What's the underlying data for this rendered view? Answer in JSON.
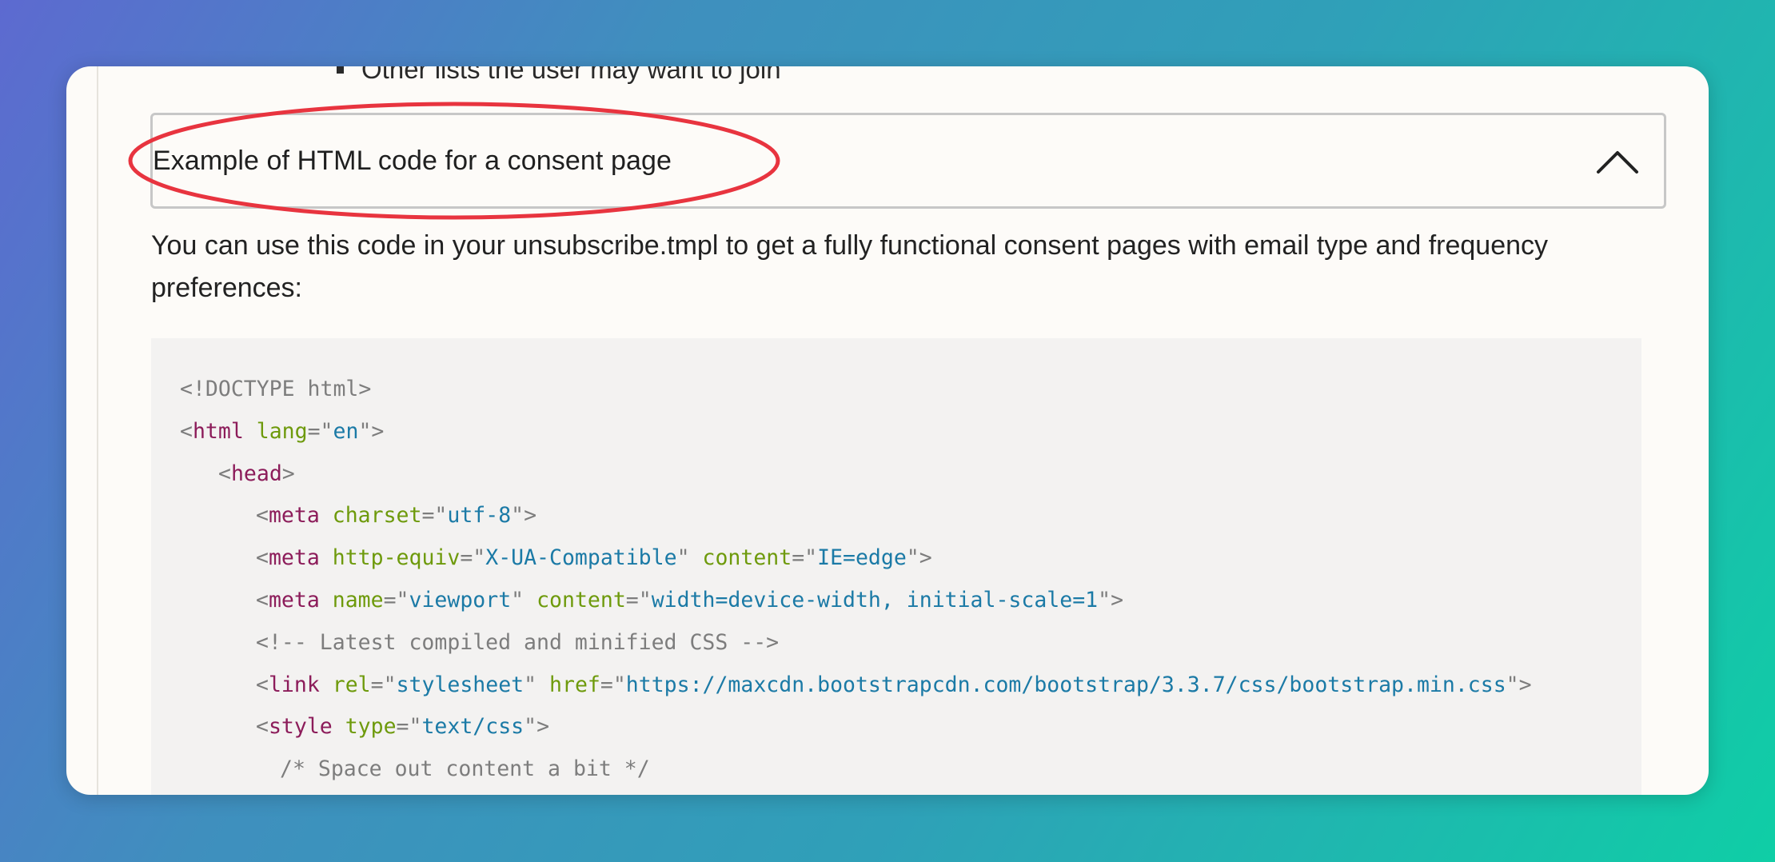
{
  "bullet": {
    "text": "Other lists the user may want to join"
  },
  "accordion": {
    "title": "Example of HTML code for a consent page",
    "chevron_icon": "chevron-up-icon",
    "expanded": true
  },
  "annotation": {
    "color": "#e8343f",
    "shape": "ellipse"
  },
  "intro": {
    "text": "You can use this code in your unsubscribe.tmpl to get a fully functional consent pages with email type and frequency preferences:"
  },
  "code": {
    "lines": [
      {
        "indent": 0,
        "tokens": [
          {
            "t": "punc",
            "v": "<!DOCTYPE html>"
          }
        ]
      },
      {
        "indent": 0,
        "tokens": [
          {
            "t": "punc",
            "v": "<"
          },
          {
            "t": "tag",
            "v": "html"
          },
          {
            "t": "plain",
            "v": " "
          },
          {
            "t": "attr",
            "v": "lang"
          },
          {
            "t": "punc",
            "v": "=\""
          },
          {
            "t": "val",
            "v": "en"
          },
          {
            "t": "punc",
            "v": "\">"
          }
        ]
      },
      {
        "indent": 1,
        "tokens": [
          {
            "t": "punc",
            "v": "<"
          },
          {
            "t": "tag",
            "v": "head"
          },
          {
            "t": "punc",
            "v": ">"
          }
        ]
      },
      {
        "indent": 2,
        "tokens": [
          {
            "t": "punc",
            "v": "<"
          },
          {
            "t": "tag",
            "v": "meta"
          },
          {
            "t": "plain",
            "v": " "
          },
          {
            "t": "attr",
            "v": "charset"
          },
          {
            "t": "punc",
            "v": "=\""
          },
          {
            "t": "val",
            "v": "utf-8"
          },
          {
            "t": "punc",
            "v": "\">"
          }
        ]
      },
      {
        "indent": 2,
        "tokens": [
          {
            "t": "punc",
            "v": "<"
          },
          {
            "t": "tag",
            "v": "meta"
          },
          {
            "t": "plain",
            "v": " "
          },
          {
            "t": "attr",
            "v": "http-equiv"
          },
          {
            "t": "punc",
            "v": "=\""
          },
          {
            "t": "val",
            "v": "X-UA-Compatible"
          },
          {
            "t": "punc",
            "v": "\""
          },
          {
            "t": "plain",
            "v": " "
          },
          {
            "t": "attr",
            "v": "content"
          },
          {
            "t": "punc",
            "v": "=\""
          },
          {
            "t": "val",
            "v": "IE=edge"
          },
          {
            "t": "punc",
            "v": "\">"
          }
        ]
      },
      {
        "indent": 2,
        "tokens": [
          {
            "t": "punc",
            "v": "<"
          },
          {
            "t": "tag",
            "v": "meta"
          },
          {
            "t": "plain",
            "v": " "
          },
          {
            "t": "attr",
            "v": "name"
          },
          {
            "t": "punc",
            "v": "=\""
          },
          {
            "t": "val",
            "v": "viewport"
          },
          {
            "t": "punc",
            "v": "\""
          },
          {
            "t": "plain",
            "v": " "
          },
          {
            "t": "attr",
            "v": "content"
          },
          {
            "t": "punc",
            "v": "=\""
          },
          {
            "t": "val",
            "v": "width=device-width, initial-scale=1"
          },
          {
            "t": "punc",
            "v": "\">"
          }
        ]
      },
      {
        "indent": 2,
        "tokens": [
          {
            "t": "com",
            "v": "<!-- Latest compiled and minified CSS -->"
          }
        ]
      },
      {
        "indent": 2,
        "tokens": [
          {
            "t": "punc",
            "v": "<"
          },
          {
            "t": "tag",
            "v": "link"
          },
          {
            "t": "plain",
            "v": " "
          },
          {
            "t": "attr",
            "v": "rel"
          },
          {
            "t": "punc",
            "v": "=\""
          },
          {
            "t": "val",
            "v": "stylesheet"
          },
          {
            "t": "punc",
            "v": "\""
          },
          {
            "t": "plain",
            "v": " "
          },
          {
            "t": "attr",
            "v": "href"
          },
          {
            "t": "punc",
            "v": "=\""
          },
          {
            "t": "val",
            "v": "https://maxcdn.bootstrapcdn.com/bootstrap/3.3.7/css/bootstrap.min.css"
          },
          {
            "t": "punc",
            "v": "\">"
          }
        ]
      },
      {
        "indent": 2,
        "tokens": [
          {
            "t": "punc",
            "v": "<"
          },
          {
            "t": "tag",
            "v": "style"
          },
          {
            "t": "plain",
            "v": " "
          },
          {
            "t": "attr",
            "v": "type"
          },
          {
            "t": "punc",
            "v": "=\""
          },
          {
            "t": "val",
            "v": "text/css"
          },
          {
            "t": "punc",
            "v": "\">"
          }
        ]
      },
      {
        "indent": 3,
        "tokens": [
          {
            "t": "com",
            "v": "/* Space out content a bit */"
          }
        ]
      }
    ]
  }
}
